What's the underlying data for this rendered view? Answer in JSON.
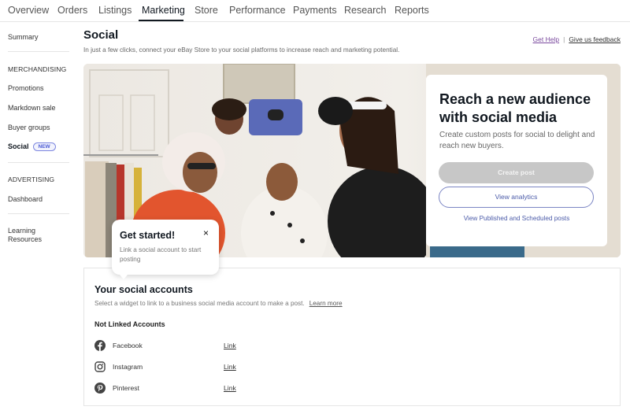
{
  "topnav": {
    "tabs": [
      {
        "label": "Overview"
      },
      {
        "label": "Orders"
      },
      {
        "label": "Listings"
      },
      {
        "label": "Marketing",
        "active": true
      },
      {
        "label": "Store"
      },
      {
        "label": "Performance"
      },
      {
        "label": "Payments"
      },
      {
        "label": "Research"
      },
      {
        "label": "Reports"
      }
    ]
  },
  "sidebar": {
    "summary": "Summary",
    "merchandising_heading": "MERCHANDISING",
    "merch_items": [
      "Promotions",
      "Markdown sale",
      "Buyer groups"
    ],
    "social": {
      "label": "Social",
      "badge": "NEW"
    },
    "advertising_heading": "ADVERTISING",
    "dashboard": "Dashboard",
    "learning": [
      "Learning",
      "Resources"
    ]
  },
  "header": {
    "title": "Social",
    "subtitle": "In just a few clicks, connect your eBay Store to your social platforms to increase reach and marketing potential.",
    "get_help": "Get Help",
    "separator": "|",
    "feedback": "Give us feedback"
  },
  "hero": {
    "title": "Reach a new audience with social media",
    "description": "Create custom posts for social to delight and reach new buyers.",
    "create_post": "Create post",
    "view_analytics": "View analytics",
    "view_posts": "View Published and Scheduled posts",
    "image_alt": "Group of friends taking a selfie"
  },
  "tooltip": {
    "title": "Get started!",
    "close": "×",
    "text": "Link a social account to start posting"
  },
  "accounts": {
    "title": "Your social accounts",
    "subtitle": "Select a widget to link to a business social media account to make a post.",
    "learn_more": "Learn more",
    "not_linked_heading": "Not Linked Accounts",
    "items": [
      {
        "name": "Facebook",
        "icon": "facebook-icon",
        "action": "Link"
      },
      {
        "name": "Instagram",
        "icon": "instagram-icon",
        "action": "Link"
      },
      {
        "name": "Pinterest",
        "icon": "pinterest-icon",
        "action": "Link"
      }
    ]
  },
  "colors": {
    "accent_link": "#4a5aa8",
    "badge": "#4a5ad4",
    "disabled_button": "#c7c7c7",
    "help_link": "#7a4a9e"
  }
}
